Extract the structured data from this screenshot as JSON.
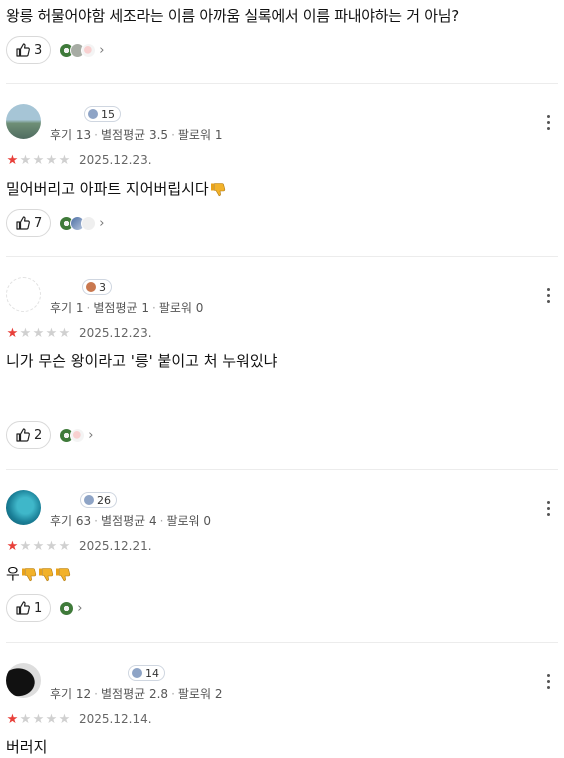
{
  "top_comment": {
    "text": "왕릉 허물어야함 세조라는 이름 아까움 실록에서 이름 파내야하는 거 아님?",
    "likes": "3"
  },
  "reviews": [
    {
      "name": "",
      "level": "15",
      "reviews_label": "후기 13",
      "avg_label": "별점평균 3.5",
      "followers_label": "팔로워 1",
      "rating": 1,
      "date": "2025.12.23.",
      "text": "밀어버리고 아파트 지어버립시다",
      "emoji": "thumbs-down",
      "likes": "7"
    },
    {
      "name": "",
      "level": "3",
      "reviews_label": "후기 1",
      "avg_label": "별점평균 1",
      "followers_label": "팔로워 0",
      "rating": 1,
      "date": "2025.12.23.",
      "text": "니가 무슨 왕이라고 '릉' 붙이고 처 누워있냐",
      "likes": "2"
    },
    {
      "name": "",
      "level": "26",
      "reviews_label": "후기 63",
      "avg_label": "별점평균 4",
      "followers_label": "팔로워 0",
      "rating": 1,
      "date": "2025.12.21.",
      "text": "우",
      "emoji": "thumbs-down x3",
      "likes": "1"
    },
    {
      "name": "",
      "level": "14",
      "reviews_label": "후기 12",
      "avg_label": "별점평균 2.8",
      "followers_label": "팔로워 2",
      "rating": 1,
      "date": "2025.12.14.",
      "text": "버러지"
    }
  ],
  "colors": {
    "star_on": "#e8403a",
    "star_off": "#d0d0d0",
    "emoji": "#f2b22a"
  }
}
